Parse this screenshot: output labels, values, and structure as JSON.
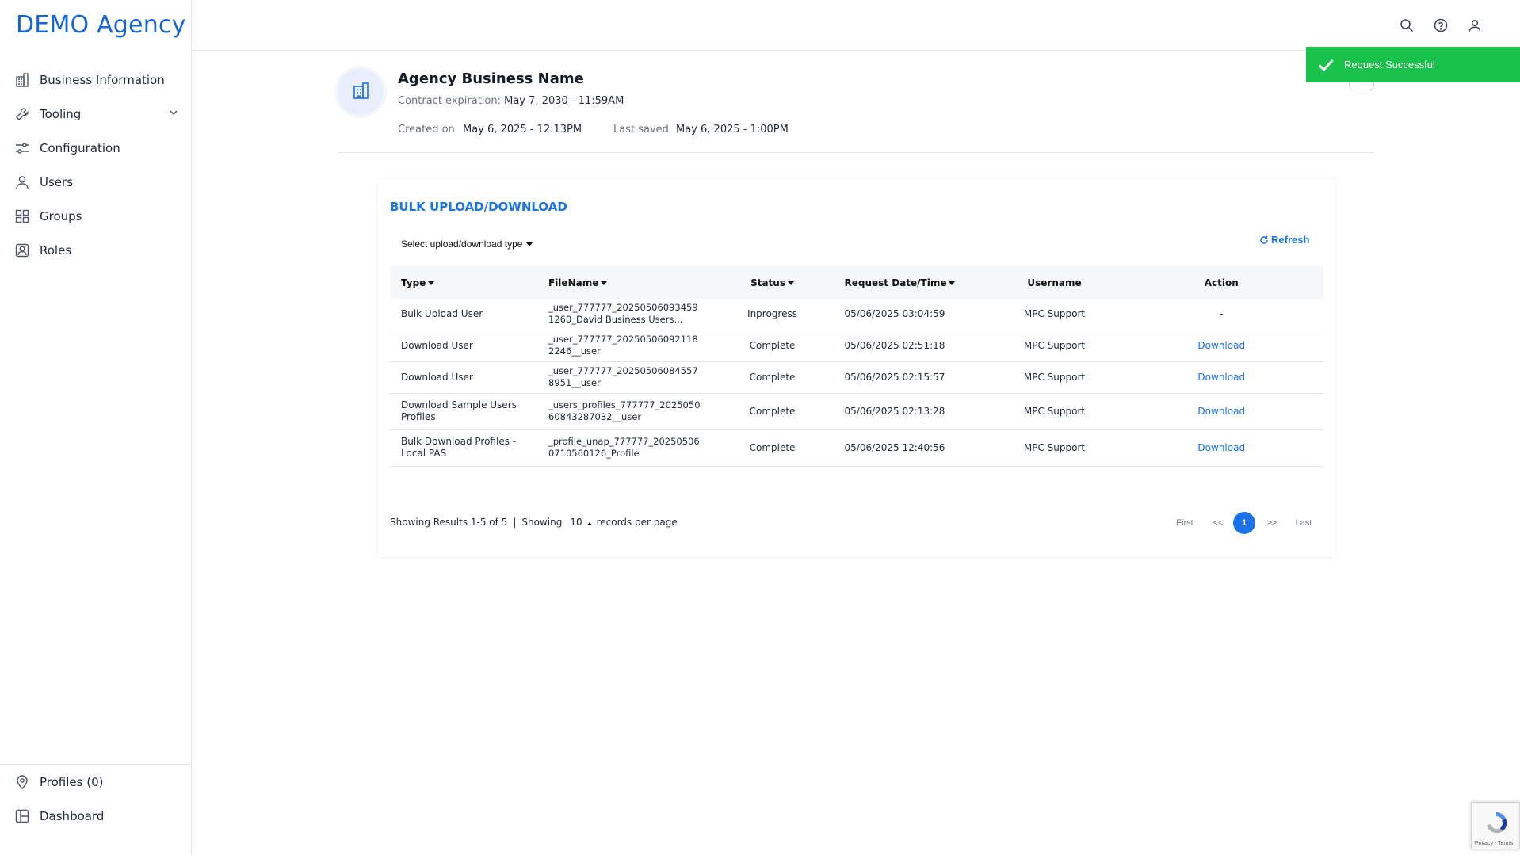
{
  "brand": "DEMO Agency",
  "sidebar": {
    "items": [
      {
        "label": "Business Information",
        "icon": "building-icon"
      },
      {
        "label": "Tooling",
        "icon": "wrench-icon"
      },
      {
        "label": "Configuration",
        "icon": "sliders-icon"
      },
      {
        "label": "Users",
        "icon": "user-icon"
      },
      {
        "label": "Groups",
        "icon": "grid-icon"
      },
      {
        "label": "Roles",
        "icon": "id-badge-icon"
      }
    ],
    "bottom": [
      {
        "label": "Profiles (0)",
        "icon": "location-pin-icon"
      },
      {
        "label": "Dashboard",
        "icon": "dashboard-icon"
      }
    ]
  },
  "topbar": {
    "icons": [
      "search-icon",
      "help-icon",
      "account-icon"
    ]
  },
  "header": {
    "business_name": "Agency Business Name",
    "contract_label": "Contract expiration:",
    "contract_value": "May 7, 2030 - 11:59AM",
    "created_label": "Created on",
    "created_value": "May 6, 2025 - 12:13PM",
    "saved_label": "Last saved",
    "saved_value": "May 6, 2025 - 1:00PM"
  },
  "toast": {
    "message": "Request Successful",
    "color": "#19c24a"
  },
  "card": {
    "title": "BULK UPLOAD/DOWNLOAD",
    "select_label": "Select upload/download type",
    "refresh_label": "Refresh",
    "columns": [
      "Type",
      "FileName",
      "Status",
      "Request Date/Time",
      "Username",
      "Action"
    ],
    "rows": [
      {
        "type": "Bulk Upload User",
        "file1": "_user_777777_20250506093459",
        "file2": "1260_David Business Users...",
        "status": "Inprogress",
        "date": "05/06/2025 03:04:59",
        "user": "MPC Support",
        "action": "-"
      },
      {
        "type": "Download User",
        "file1": "_user_777777_20250506092118",
        "file2": "2246__user",
        "status": "Complete",
        "date": "05/06/2025 02:51:18",
        "user": "MPC Support",
        "action": "Download"
      },
      {
        "type": "Download User",
        "file1": "_user_777777_20250506084557",
        "file2": "8951__user",
        "status": "Complete",
        "date": "05/06/2025 02:15:57",
        "user": "MPC Support",
        "action": "Download"
      },
      {
        "type": "Download Sample Users Profiles",
        "file1": "_users_profiles_777777_2025050",
        "file2": "60843287032__user",
        "status": "Complete",
        "date": "05/06/2025 02:13:28",
        "user": "MPC Support",
        "action": "Download"
      },
      {
        "type": "Bulk Download Profiles - Local PAS",
        "file1": "_profile_unap_777777_20250506",
        "file2": "0710560126_Profile",
        "status": "Complete",
        "date": "05/06/2025 12:40:56",
        "user": "MPC Support",
        "action": "Download"
      }
    ],
    "footer": {
      "results": "Showing Results 1-5 of 5",
      "sep": "|",
      "showing": "Showing",
      "per_page": "10",
      "records": "records per page"
    },
    "pagination": {
      "first": "First",
      "prev": "<<",
      "current": "1",
      "next": ">>",
      "last": "Last"
    }
  },
  "recaptcha": {
    "text": "Privacy - Terms"
  },
  "colors": {
    "accent": "#1a73e8",
    "brand": "#1565d8"
  }
}
